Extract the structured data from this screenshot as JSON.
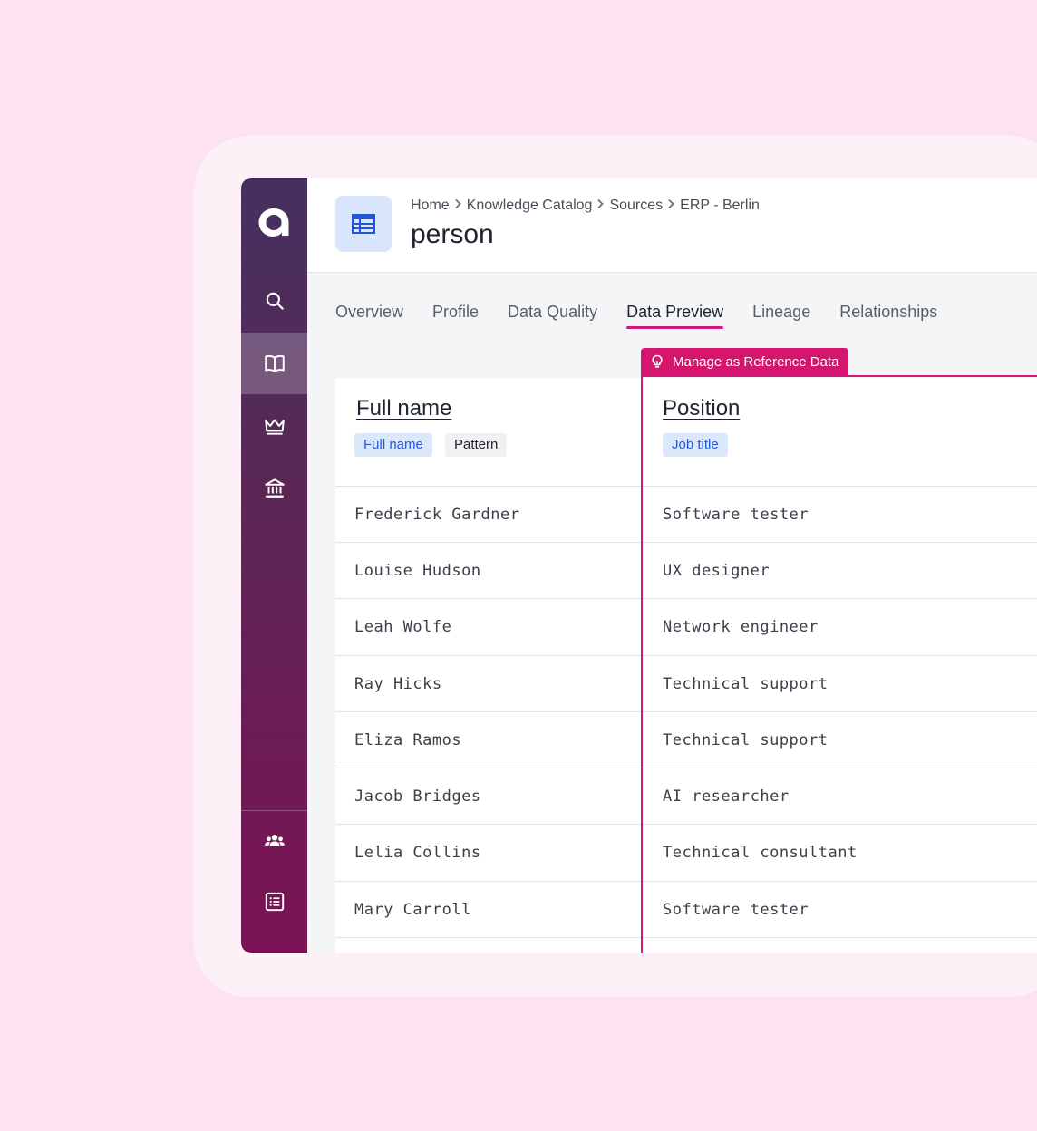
{
  "breadcrumb": {
    "items": [
      "Home",
      "Knowledge Catalog",
      "Sources",
      "ERP - Berlin"
    ]
  },
  "page_title": "person",
  "tabs": [
    {
      "label": "Overview"
    },
    {
      "label": "Profile"
    },
    {
      "label": "Data Quality"
    },
    {
      "label": "Data Preview",
      "active": true
    },
    {
      "label": "Lineage"
    },
    {
      "label": "Relationships"
    }
  ],
  "reference_badge": {
    "label": "Manage as Reference Data"
  },
  "columns": [
    {
      "title": "Full name",
      "chips": [
        "Full name",
        "Pattern"
      ]
    },
    {
      "title": "Position",
      "chips": [
        "Job title"
      ]
    }
  ],
  "rows": [
    [
      "Frederick Gardner",
      "Software tester"
    ],
    [
      "Louise Hudson",
      "UX designer"
    ],
    [
      "Leah Wolfe",
      "Network engineer"
    ],
    [
      "Ray Hicks",
      "Technical support"
    ],
    [
      "Eliza Ramos",
      "Technical support"
    ],
    [
      "Jacob Bridges",
      "AI researcher"
    ],
    [
      "Lelia Collins",
      "Technical consultant"
    ],
    [
      "Mary Carroll",
      "Software tester"
    ]
  ],
  "sidebar": {
    "icons": [
      "logo",
      "search-icon",
      "book-icon",
      "crown-icon",
      "bank-icon",
      "users-icon",
      "list-icon"
    ]
  },
  "colors": {
    "accent": "#d11a78",
    "chip_blue": "#dbe7fb",
    "background": "#fde3f2"
  }
}
